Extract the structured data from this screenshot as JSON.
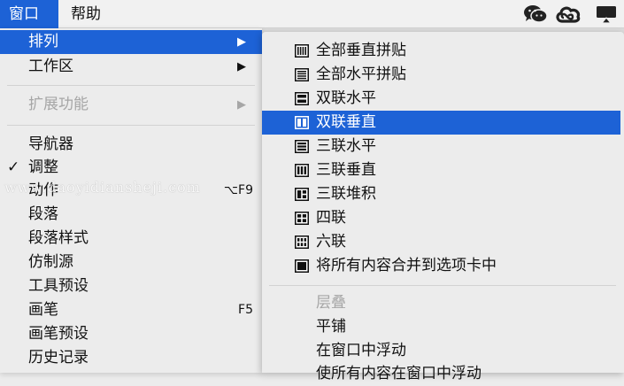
{
  "menubar": {
    "window": "窗口",
    "help": "帮助"
  },
  "tray_icons": [
    "wechat-icon",
    "creative-cloud-icon",
    "airplay-icon"
  ],
  "left_menu": [
    {
      "label": "排列",
      "arrow": "▶",
      "state": "selected"
    },
    {
      "label": "工作区",
      "arrow": "▶"
    },
    {
      "label": "扩展功能",
      "arrow": "▶",
      "state": "disabled"
    },
    {
      "label": "导航器"
    },
    {
      "label": "调整",
      "check": "✓"
    },
    {
      "label": "动作",
      "shortcut": "⌥F9"
    },
    {
      "label": "段落"
    },
    {
      "label": "段落样式"
    },
    {
      "label": "仿制源"
    },
    {
      "label": "工具预设"
    },
    {
      "label": "画笔",
      "shortcut": "F5"
    },
    {
      "label": "画笔预设"
    },
    {
      "label": "历史记录"
    }
  ],
  "right_menu": [
    {
      "label": "全部垂直拼贴",
      "icon": "tile-all-vertical-icon"
    },
    {
      "label": "全部水平拼贴",
      "icon": "tile-all-horizontal-icon"
    },
    {
      "label": "双联水平",
      "icon": "two-up-horizontal-icon"
    },
    {
      "label": "双联垂直",
      "icon": "two-up-vertical-icon",
      "state": "selected"
    },
    {
      "label": "三联水平",
      "icon": "three-up-horizontal-icon"
    },
    {
      "label": "三联垂直",
      "icon": "three-up-vertical-icon"
    },
    {
      "label": "三联堆积",
      "icon": "three-up-stacked-icon"
    },
    {
      "label": "四联",
      "icon": "four-up-icon"
    },
    {
      "label": "六联",
      "icon": "six-up-icon"
    },
    {
      "label": "将所有内容合并到选项卡中",
      "icon": "consolidate-tabs-icon"
    },
    {
      "label": "层叠",
      "state": "disabled"
    },
    {
      "label": "平铺"
    },
    {
      "label": "在窗口中浮动"
    },
    {
      "label": "使所有内容在窗口中浮动"
    }
  ],
  "watermark": "www.daoyidiansheji.com",
  "colors": {
    "accent": "#1d62d6",
    "menu_bg": "#ececec",
    "disabled": "#a6a6a6"
  }
}
